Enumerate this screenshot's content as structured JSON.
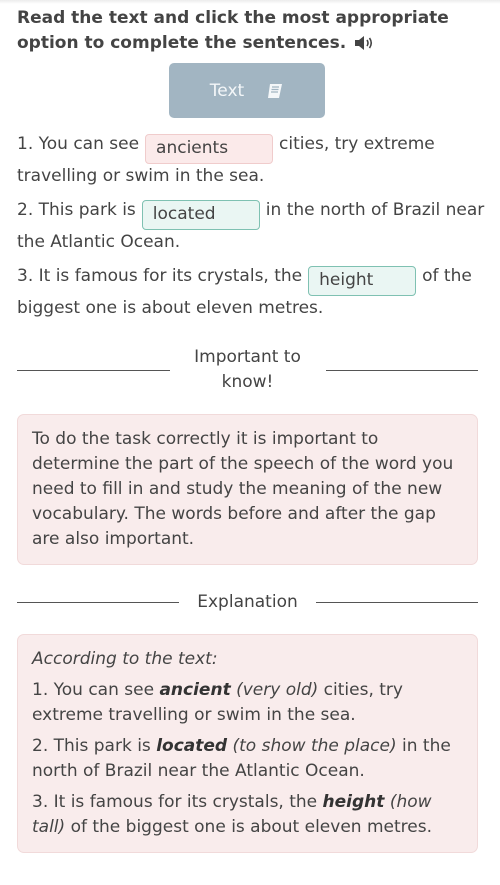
{
  "instruction": "Read the text and click the most appropriate option to complete the sentences.",
  "text_button": {
    "label": "Text",
    "icon": "book-icon"
  },
  "speaker_icon": "speaker-icon",
  "sentences": [
    {
      "before": "1. You can see",
      "answer": "ancients",
      "status": "incorrect",
      "after": "cities, try extreme travelling or swim in the sea."
    },
    {
      "before": "2. This park is",
      "answer": "located",
      "status": "correct",
      "after": "in the north of Brazil near the Atlantic Ocean."
    },
    {
      "before": "3. It is famous for its crystals, the",
      "answer": "height",
      "status": "correct",
      "after": "of the biggest one is about eleven metres."
    }
  ],
  "important": {
    "heading": "Important to know!",
    "body": "To do the task correctly it is important to determine the part of the speech of the word you need to fill in and study the meaning of the new vocabulary. The words before and after the gap are also important."
  },
  "explanation": {
    "heading": "Explanation",
    "intro": "According to the text:",
    "items": [
      {
        "before": "1. You can see",
        "word": "ancient",
        "gloss": "(very old)",
        "after": "cities, try extreme travelling or swim in the sea."
      },
      {
        "before": "2. This park is",
        "word": "located",
        "gloss": "(to show the place)",
        "after": "in the north of Brazil near the Atlantic Ocean."
      },
      {
        "before": "3. It is famous for its crystals, the",
        "word": "height",
        "gloss": "(how tall)",
        "after": "of the biggest one is about eleven metres."
      }
    ]
  },
  "colors": {
    "incorrect_bg": "#fbeaea",
    "correct_border": "#7fc1b2",
    "button_bg": "#a2b5c2",
    "info_bg": "#f9ecec"
  }
}
